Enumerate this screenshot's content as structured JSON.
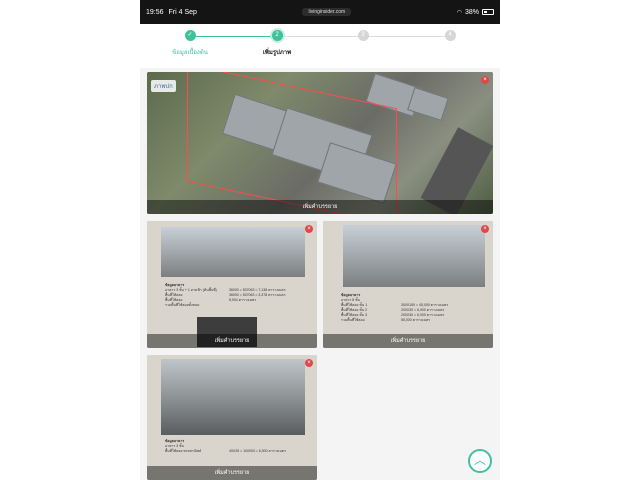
{
  "statusbar": {
    "time": "19:56",
    "date": "Fri 4 Sep",
    "url": "livinginsider.com",
    "battery": "38%"
  },
  "stepper": [
    {
      "num": "✓",
      "label": "ข้อมูลเบื้องต้น",
      "state": "done"
    },
    {
      "num": "2",
      "label": "เพิ่มรูปภาพ",
      "state": "active"
    },
    {
      "num": "3",
      "label": "",
      "state": "todo"
    },
    {
      "num": "4",
      "label": "",
      "state": "todo"
    }
  ],
  "cards": [
    {
      "caption": "เพิ่มคำบรรยาย",
      "tag": "ภาพปก"
    },
    {
      "caption": "เพิ่มคำบรรยาย"
    },
    {
      "caption": "เพิ่มคำบรรยาย"
    },
    {
      "caption": "เพิ่มคำบรรยาย"
    }
  ],
  "doc_texts": {
    "card2": [
      "ข้อมูลอาคาร",
      "อาคาร 3 ชั้น + 1 ดาดฟ้า (ค้นพื้นที่)",
      "พื้นที่ใช้สอย",
      "พื้นที่ใช้สอย",
      "รวมพื้นที่ใช้สอยทั้งหมด"
    ],
    "card2_values": [
      "36000 = 537063 = 7,138 ตารางเมตร",
      "36000 = 537063 = 3,378 ตารางเมตร",
      "8,904 ตารางเมตร"
    ],
    "card3": [
      "ข้อมูลอาคาร",
      "อาคาร 8 ชั้น",
      "พื้นที่ใช้สอย ชั้น 1",
      "พื้นที่ใช้สอย ชั้น 2",
      "พื้นที่ใช้สอย ชั้น 3",
      "รวมพื้นที่ใช้สอย"
    ],
    "card3_values": [
      "300X150 = 45,000 ตารางเมตร",
      "200X30 = 6,000 ตารางเมตร",
      "200X30 = 6,000 ตารางเมตร",
      "55,000 ตารางเมตร"
    ],
    "card4": [
      "ข้อมูลอาคาร",
      "อาคาร 3 ชั้น",
      "พื้นที่ใช้สอย ทรงพาณิชย์"
    ],
    "card4_values": [
      "40X25 = 100003 = 6,000 ตารางเมตร"
    ]
  },
  "icons": {
    "delete": "close-icon",
    "scroll_top": "chevron-up-icon"
  },
  "colors": {
    "accent": "#3ec29b",
    "delete": "#e04848"
  }
}
